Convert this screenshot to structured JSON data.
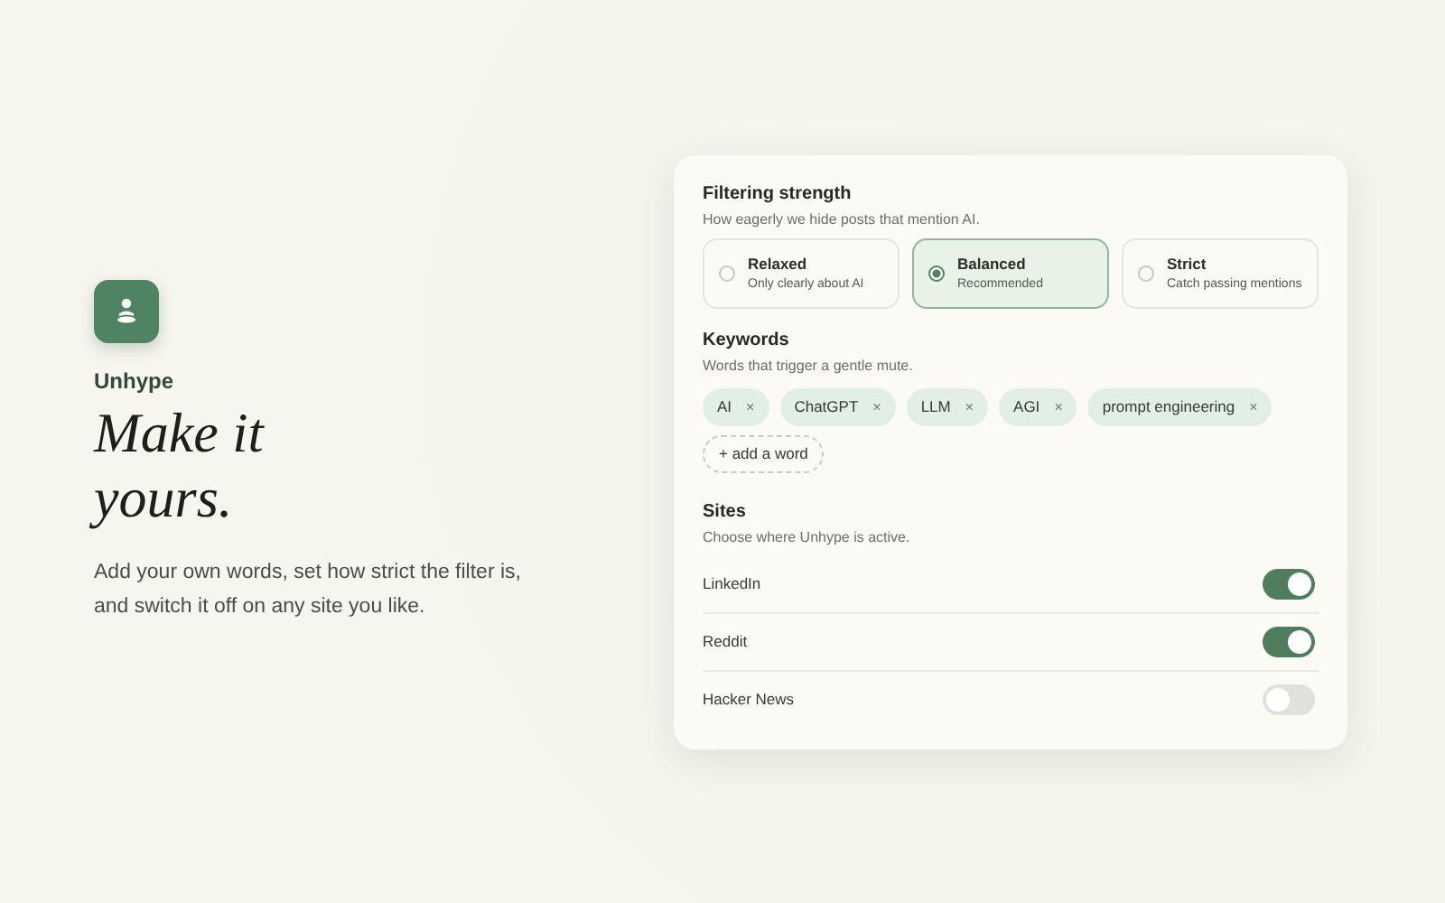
{
  "brand": {
    "name": "Unhype"
  },
  "headline": [
    "Make it",
    "yours."
  ],
  "intro": "Add your own words, set how strict the filter is, and switch it off on any site you like.",
  "strength": {
    "title": "Filtering strength",
    "subtitle": "How eagerly we hide posts that mention AI.",
    "options": [
      {
        "label": "Relaxed",
        "hint": "Only clearly about AI",
        "selected": false
      },
      {
        "label": "Balanced",
        "hint": "Recommended",
        "selected": true
      },
      {
        "label": "Strict",
        "hint": "Catch passing mentions",
        "selected": false
      }
    ]
  },
  "keywords": {
    "title": "Keywords",
    "subtitle": "Words that trigger a gentle mute.",
    "chips": [
      {
        "label": "AI",
        "remove": "×"
      },
      {
        "label": "ChatGPT",
        "remove": "×"
      },
      {
        "label": "LLM",
        "remove": "×"
      },
      {
        "label": "AGI",
        "remove": "×"
      },
      {
        "label": "prompt engineering",
        "remove": "×"
      }
    ],
    "add_label": "+ add a word"
  },
  "sites": {
    "title": "Sites",
    "subtitle": "Choose where Unhype is active.",
    "items": [
      {
        "name": "LinkedIn",
        "on": true
      },
      {
        "name": "Reddit",
        "on": true
      },
      {
        "name": "Hacker News",
        "on": false
      }
    ]
  }
}
